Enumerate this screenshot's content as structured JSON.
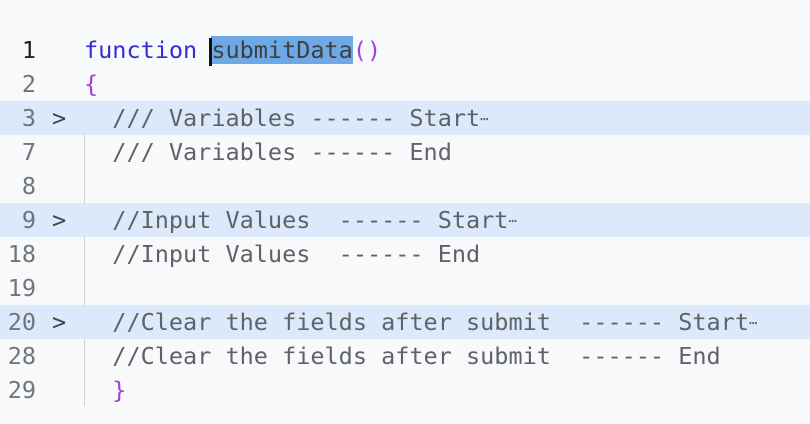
{
  "editor": {
    "lines": [
      {
        "num": "1",
        "keyword": "function",
        "name": "submitData",
        "parens": "()"
      },
      {
        "num": "2",
        "text": "{"
      },
      {
        "num": "3",
        "text": "  /// Variables ------ Start",
        "folded": true
      },
      {
        "num": "7",
        "text": "  /// Variables ------ End"
      },
      {
        "num": "8",
        "text": ""
      },
      {
        "num": "9",
        "text": "  //Input Values  ------ Start",
        "folded": true
      },
      {
        "num": "18",
        "text": "  //Input Values  ------ End"
      },
      {
        "num": "19",
        "text": ""
      },
      {
        "num": "20",
        "text": "  //Clear the fields after submit  ------ Start",
        "folded": true
      },
      {
        "num": "28",
        "text": "  //Clear the fields after submit  ------ End"
      },
      {
        "num": "29",
        "text": "  }"
      }
    ],
    "fold_icon": "chevron-right-icon",
    "ellipsis": "⋯"
  }
}
